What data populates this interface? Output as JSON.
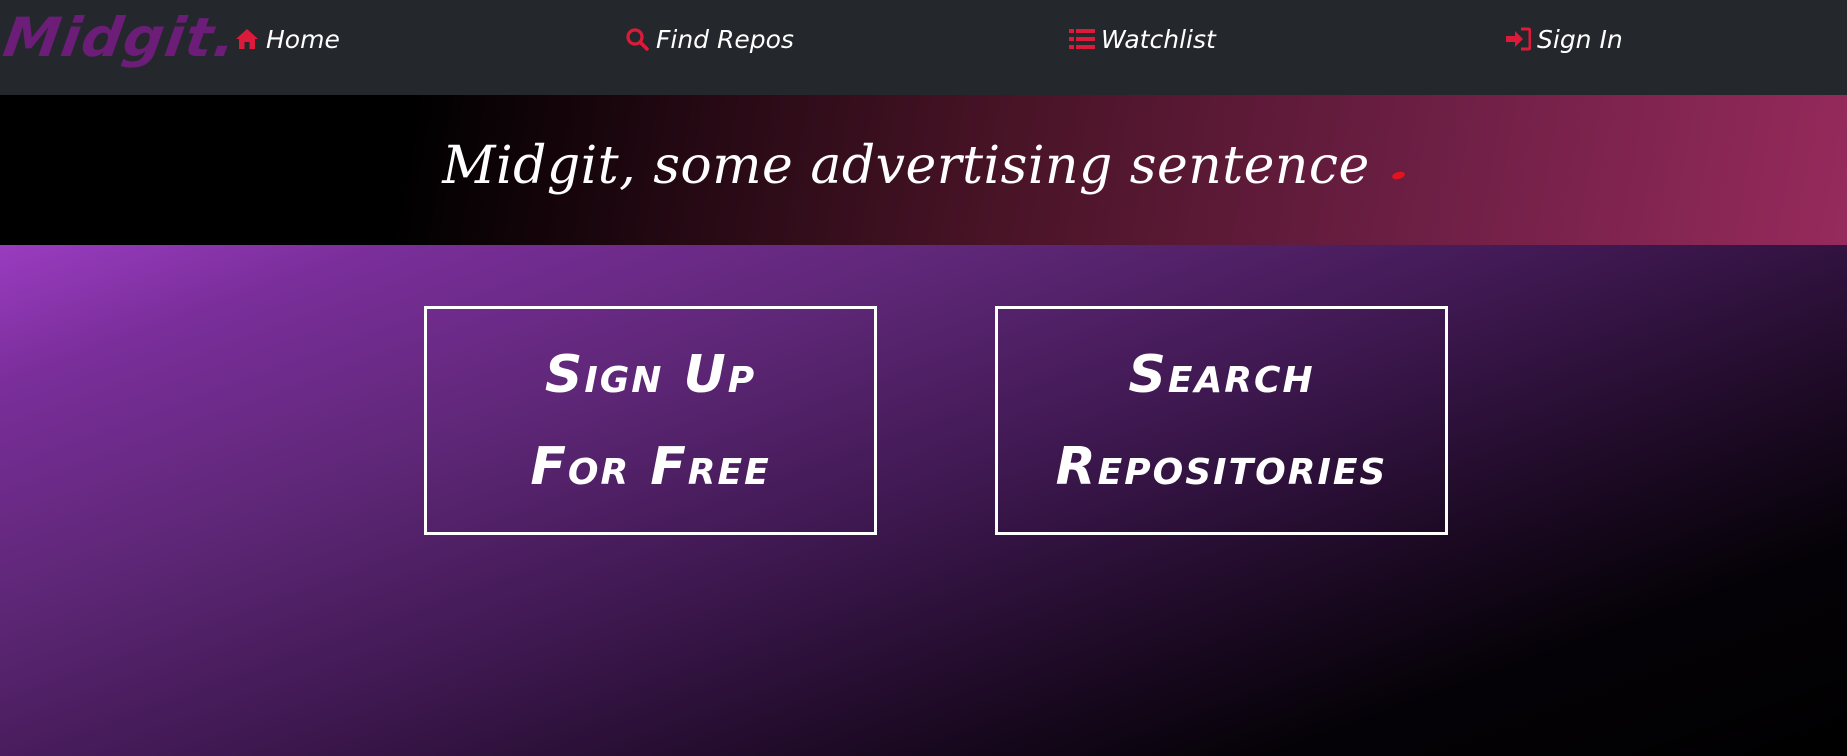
{
  "navbar": {
    "logo_text": "Midgit.",
    "items": [
      {
        "label": "Home",
        "icon": "home-icon"
      },
      {
        "label": "Find Repos",
        "icon": "search-icon"
      },
      {
        "label": "Watchlist",
        "icon": "list-icon"
      },
      {
        "label": "Sign In",
        "icon": "sign-in-icon"
      }
    ]
  },
  "hero": {
    "tagline": "Midgit, some advertising sentence"
  },
  "cta": {
    "signup_label": "Sign Up\nFor Free",
    "search_label": "Search\nRepositories"
  },
  "colors": {
    "accent": "#dc1b3a",
    "logo": "#6b1d78",
    "navbar_bg": "#24282c",
    "hero_dot": "#e0151f"
  }
}
